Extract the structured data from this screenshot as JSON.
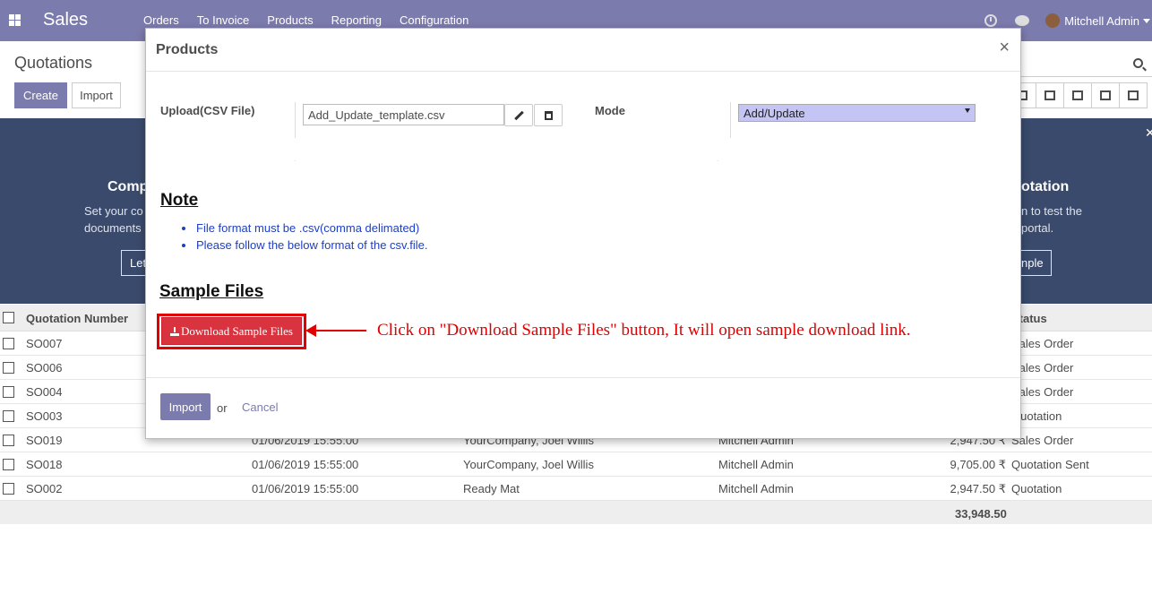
{
  "navbar": {
    "brand": "Sales",
    "menu": [
      "Orders",
      "To Invoice",
      "Products",
      "Reporting",
      "Configuration"
    ],
    "user": "Mitchell Admin"
  },
  "control_panel": {
    "title": "Quotations",
    "create_label": "Create",
    "import_label": "Import"
  },
  "banner": {
    "left_title": "Comp",
    "left_text": [
      "Set your co",
      "documents"
    ],
    "left_button": "Let",
    "right_title": "otation",
    "right_text": [
      "n to test the",
      "portal."
    ],
    "right_button": "nple"
  },
  "list": {
    "headers": {
      "number": "Quotation Number",
      "status": "Status"
    },
    "rows": [
      {
        "number": "SO007",
        "date": "",
        "customer": "",
        "salesperson": "",
        "total": "",
        "status": "Sales Order"
      },
      {
        "number": "SO006",
        "date": "",
        "customer": "",
        "salesperson": "",
        "total": "",
        "status": "Sales Order"
      },
      {
        "number": "SO004",
        "date": "",
        "customer": "",
        "salesperson": "",
        "total": "",
        "status": "Sales Order"
      },
      {
        "number": "SO003",
        "date": "",
        "customer": "",
        "salesperson": "",
        "total": "",
        "status": "Quotation"
      },
      {
        "number": "SO019",
        "date": "01/06/2019 15:55:00",
        "customer": "YourCompany, Joel Willis",
        "salesperson": "Mitchell Admin",
        "total": "2,947.50 ₹",
        "status": "Sales Order"
      },
      {
        "number": "SO018",
        "date": "01/06/2019 15:55:00",
        "customer": "YourCompany, Joel Willis",
        "salesperson": "Mitchell Admin",
        "total": "9,705.00 ₹",
        "status": "Quotation Sent"
      },
      {
        "number": "SO002",
        "date": "01/06/2019 15:55:00",
        "customer": "Ready Mat",
        "salesperson": "Mitchell Admin",
        "total": "2,947.50 ₹",
        "status": "Quotation"
      }
    ],
    "footer_total": "33,948.50"
  },
  "modal": {
    "title": "Products",
    "close": "×",
    "upload_label": "Upload(CSV File)",
    "file_name": "Add_Update_template.csv",
    "mode_label": "Mode",
    "mode_value": "Add/Update",
    "note_heading": "Note",
    "notes": [
      "File format must be .csv(comma delimated)",
      "Please follow the below format of the csv.file."
    ],
    "sample_heading": "Sample Files",
    "download_label": "Download Sample Files",
    "callout": "Click on \"Download Sample Files\" button, It will open sample download link.",
    "import_label": "Import",
    "or_text": "or",
    "cancel_label": "Cancel"
  },
  "colors": {
    "navbar": "#7c7bad",
    "primary": "#7c7bad",
    "danger": "#d9333f",
    "annotation": "#e00000",
    "note_text": "#1c3fc4",
    "mode_select_bg": "#c5c5f5"
  }
}
